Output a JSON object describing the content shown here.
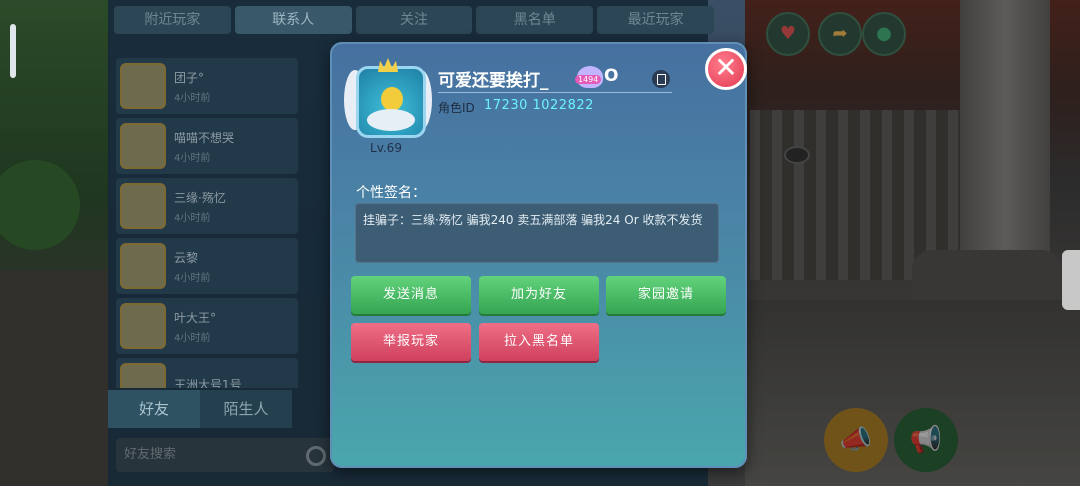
{
  "social": {
    "top_tabs": [
      "附近玩家",
      "联系人",
      "关注",
      "黑名单",
      "最近玩家"
    ],
    "friends": [
      {
        "name": "团子°",
        "sub": "4小时前"
      },
      {
        "name": "喵喵不想哭",
        "sub": "4小时前"
      },
      {
        "name": "三缘·殇忆",
        "sub": "4小时前"
      },
      {
        "name": "云黎",
        "sub": "4小时前"
      },
      {
        "name": "叶大王°",
        "sub": "4小时前"
      },
      {
        "name": "王洲大号1号",
        "sub": ""
      }
    ],
    "bottom_tabs": [
      "好友",
      "陌生人"
    ],
    "search_placeholder": "好友搜索"
  },
  "profile": {
    "name_prefix": "可爱还要挨打_",
    "name_suffix": "O",
    "heart_badge": "1494",
    "level": "Lv.69",
    "role_id_label": "角色ID",
    "role_id": "17230 1022822",
    "signature_label": "个性签名：",
    "signature": "挂骗子：三缘·殇忆 骗我240 卖五满部落 骗我24 Or 收款不发货",
    "close_symbol": "✕"
  },
  "buttons": {
    "send_message": "发送消息",
    "add_friend": "加为好友",
    "home_invite": "家园邀请",
    "report": "举报玩家",
    "blacklist": "拉入黑名单"
  }
}
